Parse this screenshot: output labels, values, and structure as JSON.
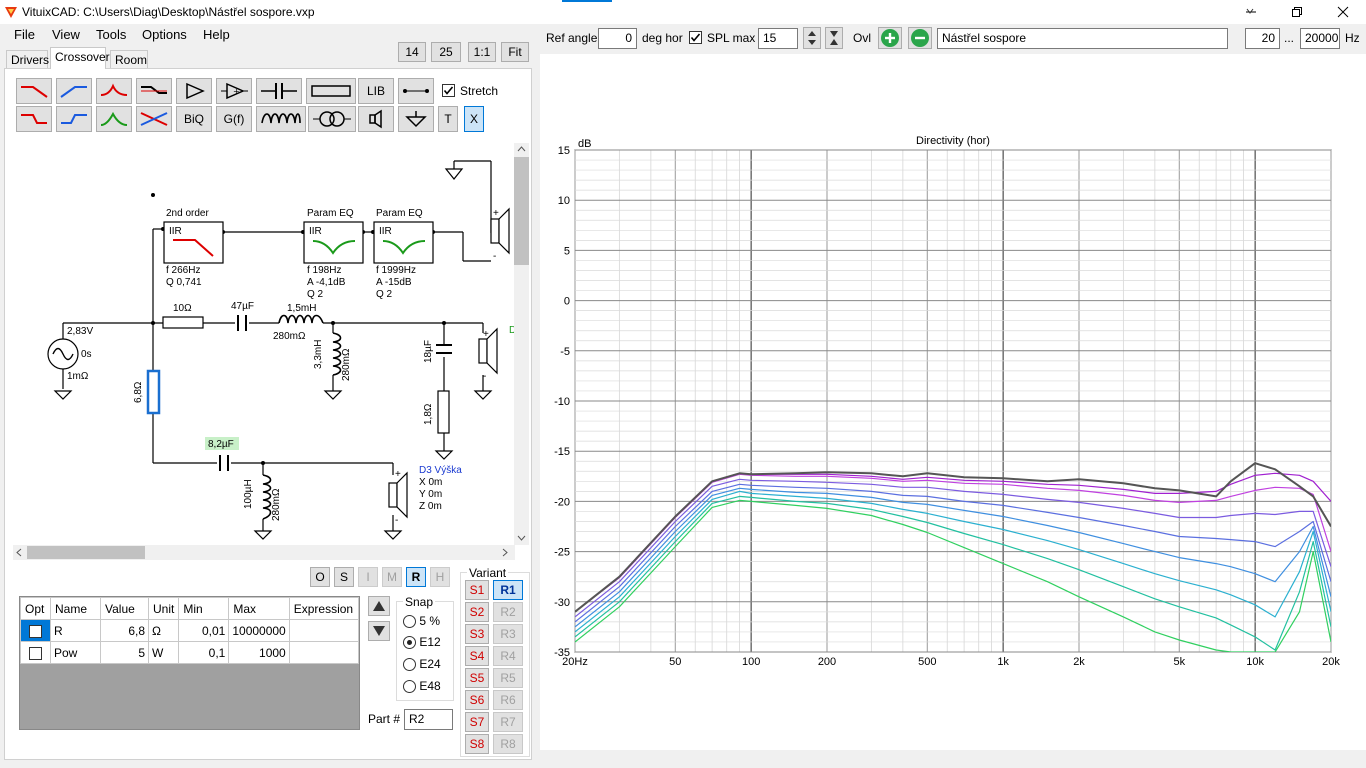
{
  "window": {
    "title": "VituixCAD: C:\\Users\\Diag\\Desktop\\Nástřel sospore.vxp",
    "min_icon": "minimize-icon",
    "max_icon": "maximize-icon",
    "close_icon": "close-icon"
  },
  "menu": [
    "File",
    "View",
    "Tools",
    "Options",
    "Help"
  ],
  "tabs": [
    "Drivers",
    "Crossover",
    "Room"
  ],
  "zoom": {
    "a": "14",
    "b": "25",
    "c": "1:1",
    "fit": "Fit"
  },
  "toolbar": {
    "lib": "LIB",
    "biq": "BiQ",
    "gf": "G(f)",
    "t": "T",
    "x": "X",
    "stretch_label": "Stretch",
    "stretch_checked": true
  },
  "schematic": {
    "blocks": [
      {
        "title": "2nd order",
        "type": "IIR",
        "params": [
          "f   266Hz",
          "Q 0,741"
        ]
      },
      {
        "title": "Param EQ",
        "type": "IIR",
        "params": [
          "f   198Hz",
          "A  -4,1dB",
          "Q 2"
        ]
      },
      {
        "title": "Param EQ",
        "type": "IIR",
        "params": [
          "f   1999Hz",
          "A  -15dB",
          "Q 2"
        ]
      }
    ],
    "source": {
      "voltage": "2,83V",
      "delay": "0s",
      "impedance": "1mΩ"
    },
    "r_series": "10Ω",
    "c_series": "47µF",
    "l_series": "1,5mH",
    "l_series_r": "280mΩ",
    "l_shunt": "3,3mH",
    "l_shunt_r": "280mΩ",
    "c_shunt": "18µF",
    "r_shunt": "1,8Ω",
    "r_selected": "6,8Ω",
    "c_tweeter": "8,2µF",
    "l_tweeter": "100µH",
    "l_tweeter_r": "280mΩ",
    "driver_label": "D3 Výška",
    "driver_pos": [
      "X 0m",
      "Y 0m",
      "Z 0m"
    ],
    "mid_label_partial": "D"
  },
  "mode_buttons": [
    "O",
    "S",
    "I",
    "M",
    "R",
    "H"
  ],
  "mode_active": "R",
  "grid": {
    "headers": [
      "Opt",
      "Name",
      "Value",
      "Unit",
      "Min",
      "Max",
      "Expression"
    ],
    "rows": [
      {
        "opt": false,
        "name": "R",
        "value": "6,8",
        "unit": "Ω",
        "min": "0,01",
        "max": "10000000",
        "expr": ""
      },
      {
        "opt": false,
        "name": "Pow",
        "value": "5",
        "unit": "W",
        "min": "0,1",
        "max": "1000",
        "expr": ""
      }
    ]
  },
  "snap": {
    "label": "Snap",
    "options": [
      "5 %",
      "E12",
      "E24",
      "E48"
    ],
    "selected": "E12"
  },
  "part": {
    "label": "Part #",
    "value": "R2"
  },
  "variant": {
    "label": "Variant",
    "s": [
      "S1",
      "S2",
      "S3",
      "S4",
      "S5",
      "S6",
      "S7",
      "S8"
    ],
    "r": [
      "R1",
      "R2",
      "R3",
      "R4",
      "R5",
      "R6",
      "R7",
      "R8"
    ],
    "active_r": "R1"
  },
  "top_controls": {
    "ref_angle_label": "Ref angle",
    "ref_angle": "0",
    "deg_hor": "deg hor",
    "spl_max_label": "SPL max",
    "spl_max_checked": true,
    "spl_max": "15",
    "ovl_label": "Ovl",
    "name": "Nástřel sospore",
    "fmin": "20",
    "dots": "...",
    "fmax": "20000",
    "hz": "Hz"
  },
  "chart_data": {
    "type": "line",
    "title": "Directivity (hor)",
    "ylabel": "dB",
    "x_scale": "log",
    "xlim": [
      20,
      20000
    ],
    "ylim": [
      -35,
      15
    ],
    "x_ticks": [
      "20Hz",
      "50",
      "100",
      "200",
      "500",
      "1k",
      "2k",
      "5k",
      "10k",
      "20k"
    ],
    "y_ticks": [
      "15",
      "10",
      "5",
      "0",
      "-5",
      "-10",
      "-15",
      "-20",
      "-25",
      "-30",
      "-35"
    ],
    "grid": true,
    "x": [
      20,
      30,
      50,
      70,
      90,
      100,
      150,
      200,
      300,
      400,
      500,
      700,
      1000,
      1500,
      2000,
      3000,
      4000,
      5000,
      7000,
      8000,
      10000,
      12000,
      15000,
      17000,
      20000
    ],
    "series": [
      {
        "color": "#555555",
        "values": [
          -31,
          -27.5,
          -21.5,
          -18,
          -17.2,
          -17.3,
          -17.2,
          -17.1,
          -17.2,
          -17.5,
          -17.2,
          -17.6,
          -17.7,
          -18,
          -17.8,
          -18.2,
          -18.7,
          -18.9,
          -19.5,
          -18,
          -16.2,
          -16.8,
          -18.5,
          -19.5,
          -22.5
        ]
      },
      {
        "color": "#a020d0",
        "values": [
          -31,
          -27.5,
          -21.5,
          -18,
          -17.2,
          -17.3,
          -17.3,
          -17.3,
          -17.5,
          -17.8,
          -17.6,
          -17.9,
          -18,
          -18.3,
          -18.4,
          -18.8,
          -19.2,
          -19.2,
          -19,
          -18.3,
          -17.4,
          -17.2,
          -17.4,
          -18,
          -20
        ]
      },
      {
        "color": "#c040e0",
        "values": [
          -31,
          -27.6,
          -21.6,
          -18.1,
          -17.3,
          -17.4,
          -17.5,
          -17.5,
          -17.7,
          -18,
          -17.9,
          -18.2,
          -18.3,
          -18.7,
          -18.9,
          -19.4,
          -19.9,
          -20.1,
          -19.9,
          -19.5,
          -18.9,
          -18.6,
          -18.7,
          -19.3,
          -25
        ]
      },
      {
        "color": "#7b5be0",
        "values": [
          -31.5,
          -28,
          -22,
          -18.5,
          -17.8,
          -17.9,
          -18,
          -18.1,
          -18.3,
          -18.6,
          -18.6,
          -19,
          -19.3,
          -19.8,
          -20.1,
          -20.7,
          -21.2,
          -21.6,
          -21.6,
          -21.4,
          -21.2,
          -21.3,
          -21,
          -21,
          -26.5
        ]
      },
      {
        "color": "#5b6fe0",
        "values": [
          -32,
          -28.5,
          -22.5,
          -19,
          -18.3,
          -18.4,
          -18.6,
          -18.7,
          -19,
          -19.4,
          -19.5,
          -20,
          -20.4,
          -21.1,
          -21.6,
          -22.4,
          -23,
          -23.5,
          -23.7,
          -23.8,
          -24,
          -24.5,
          -23,
          -22,
          -28
        ]
      },
      {
        "color": "#3f8fe0",
        "values": [
          -32.5,
          -29,
          -23,
          -19.4,
          -18.7,
          -18.8,
          -19.1,
          -19.2,
          -19.6,
          -20.1,
          -20.3,
          -20.9,
          -21.5,
          -22.4,
          -23.1,
          -24.2,
          -25,
          -25.6,
          -26.2,
          -26.5,
          -27.2,
          -28,
          -25,
          -22.5,
          -29.5
        ]
      },
      {
        "color": "#2bb0d0",
        "values": [
          -33,
          -29.5,
          -23.5,
          -19.8,
          -19,
          -19.2,
          -19.5,
          -19.7,
          -20.2,
          -20.8,
          -21.2,
          -22,
          -22.8,
          -23.9,
          -24.8,
          -26.2,
          -27.2,
          -27.9,
          -28.8,
          -29.3,
          -30.3,
          -31.5,
          -27,
          -23,
          -31
        ]
      },
      {
        "color": "#22c0a0",
        "values": [
          -33.5,
          -30,
          -24,
          -20.2,
          -19.5,
          -19.6,
          -20,
          -20.2,
          -20.8,
          -21.5,
          -22.1,
          -23.2,
          -24.3,
          -25.7,
          -26.8,
          -28.5,
          -29.7,
          -30.5,
          -31.6,
          -32.3,
          -33.5,
          -34.8,
          -29,
          -24,
          -32.5
        ]
      },
      {
        "color": "#30d060",
        "values": [
          -34,
          -30.5,
          -24.5,
          -20.6,
          -19.9,
          -20,
          -20.4,
          -20.7,
          -21.4,
          -22.3,
          -23.1,
          -24.6,
          -26.2,
          -28,
          -29.5,
          -31.5,
          -33,
          -33.8,
          -34.8,
          -35,
          -35,
          -35,
          -31,
          -25,
          -34
        ]
      }
    ]
  }
}
